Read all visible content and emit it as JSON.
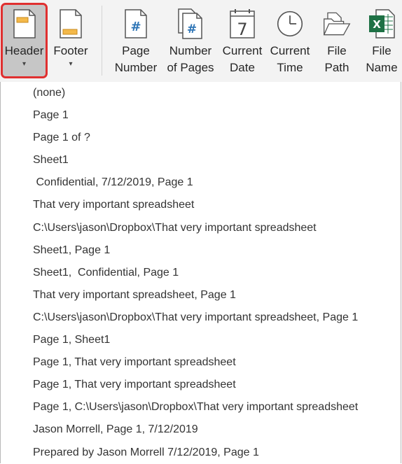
{
  "ribbon": {
    "buttons": [
      {
        "id": "header",
        "label": "Header",
        "has_dropdown": true,
        "icon": "header-page-icon",
        "active": true
      },
      {
        "id": "footer",
        "label": "Footer",
        "has_dropdown": true,
        "icon": "footer-page-icon"
      },
      {
        "id": "page-number",
        "label": "Page\nNumber",
        "icon": "page-number-icon"
      },
      {
        "id": "number-of-pages",
        "label": "Number\nof Pages",
        "icon": "number-of-pages-icon"
      },
      {
        "id": "current-date",
        "label": "Current\nDate",
        "icon": "calendar-icon"
      },
      {
        "id": "current-time",
        "label": "Current\nTime",
        "icon": "clock-icon"
      },
      {
        "id": "file-path",
        "label": "File\nPath",
        "icon": "folder-icon"
      },
      {
        "id": "file-name",
        "label": "File\nName",
        "icon": "excel-file-icon"
      }
    ],
    "caret": "▾",
    "active_border_color": "#e03030",
    "icon_accent_color": "#2e75b6",
    "icon_highlight_color": "#f4b94a",
    "excel_green": "#1e7145"
  },
  "menu": {
    "items": [
      "(none)",
      "Page 1",
      "Page 1 of ?",
      "Sheet1",
      " Confidential, 7/12/2019, Page 1",
      "That very important spreadsheet",
      "C:\\Users\\jason\\Dropbox\\That very important spreadsheet",
      "Sheet1, Page 1",
      "Sheet1,  Confidential, Page 1",
      "That very important spreadsheet, Page 1",
      "C:\\Users\\jason\\Dropbox\\That very important spreadsheet, Page 1",
      "Page 1, Sheet1",
      "Page 1, That very important spreadsheet",
      "Page 1, That very important spreadsheet",
      "Page 1, C:\\Users\\jason\\Dropbox\\That very important spreadsheet",
      "Jason Morrell, Page 1, 7/12/2019",
      "Prepared by Jason Morrell 7/12/2019, Page 1"
    ]
  }
}
